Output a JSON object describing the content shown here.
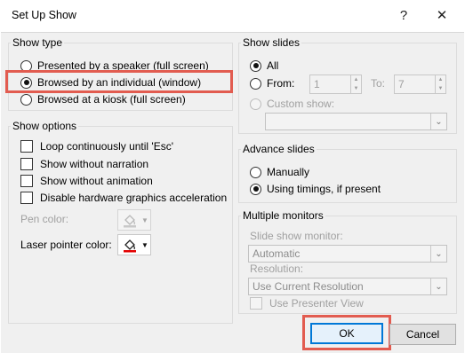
{
  "window": {
    "title": "Set Up Show",
    "help": "?",
    "close": "✕"
  },
  "show_type": {
    "legend": "Show type",
    "options": [
      {
        "label": "Presented by a speaker (full screen)",
        "checked": false
      },
      {
        "label": "Browsed by an individual (window)",
        "checked": true
      },
      {
        "label": "Browsed at a kiosk (full screen)",
        "checked": false
      }
    ]
  },
  "show_options": {
    "legend": "Show options",
    "checkboxes": [
      "Loop continuously until 'Esc'",
      "Show without narration",
      "Show without animation",
      "Disable hardware graphics acceleration"
    ],
    "pen_color_label": "Pen color:",
    "laser_pointer_color_label": "Laser pointer color:",
    "laser_color": "#e30000"
  },
  "show_slides": {
    "legend": "Show slides",
    "all_label": "All",
    "from_label": "From:",
    "from_value": "1",
    "to_label": "To:",
    "to_value": "7",
    "custom_show_label": "Custom show:",
    "custom_show_value": ""
  },
  "advance_slides": {
    "legend": "Advance slides",
    "manually_label": "Manually",
    "timings_label": "Using timings, if present"
  },
  "multiple_monitors": {
    "legend": "Multiple monitors",
    "monitor_label": "Slide show monitor:",
    "monitor_value": "Automatic",
    "resolution_label": "Resolution:",
    "resolution_value": "Use Current Resolution",
    "presenter_view_label": "Use Presenter View"
  },
  "buttons": {
    "ok": "OK",
    "cancel": "Cancel"
  },
  "colors": {
    "highlight": "#e25c50",
    "accent": "#0078d7"
  }
}
